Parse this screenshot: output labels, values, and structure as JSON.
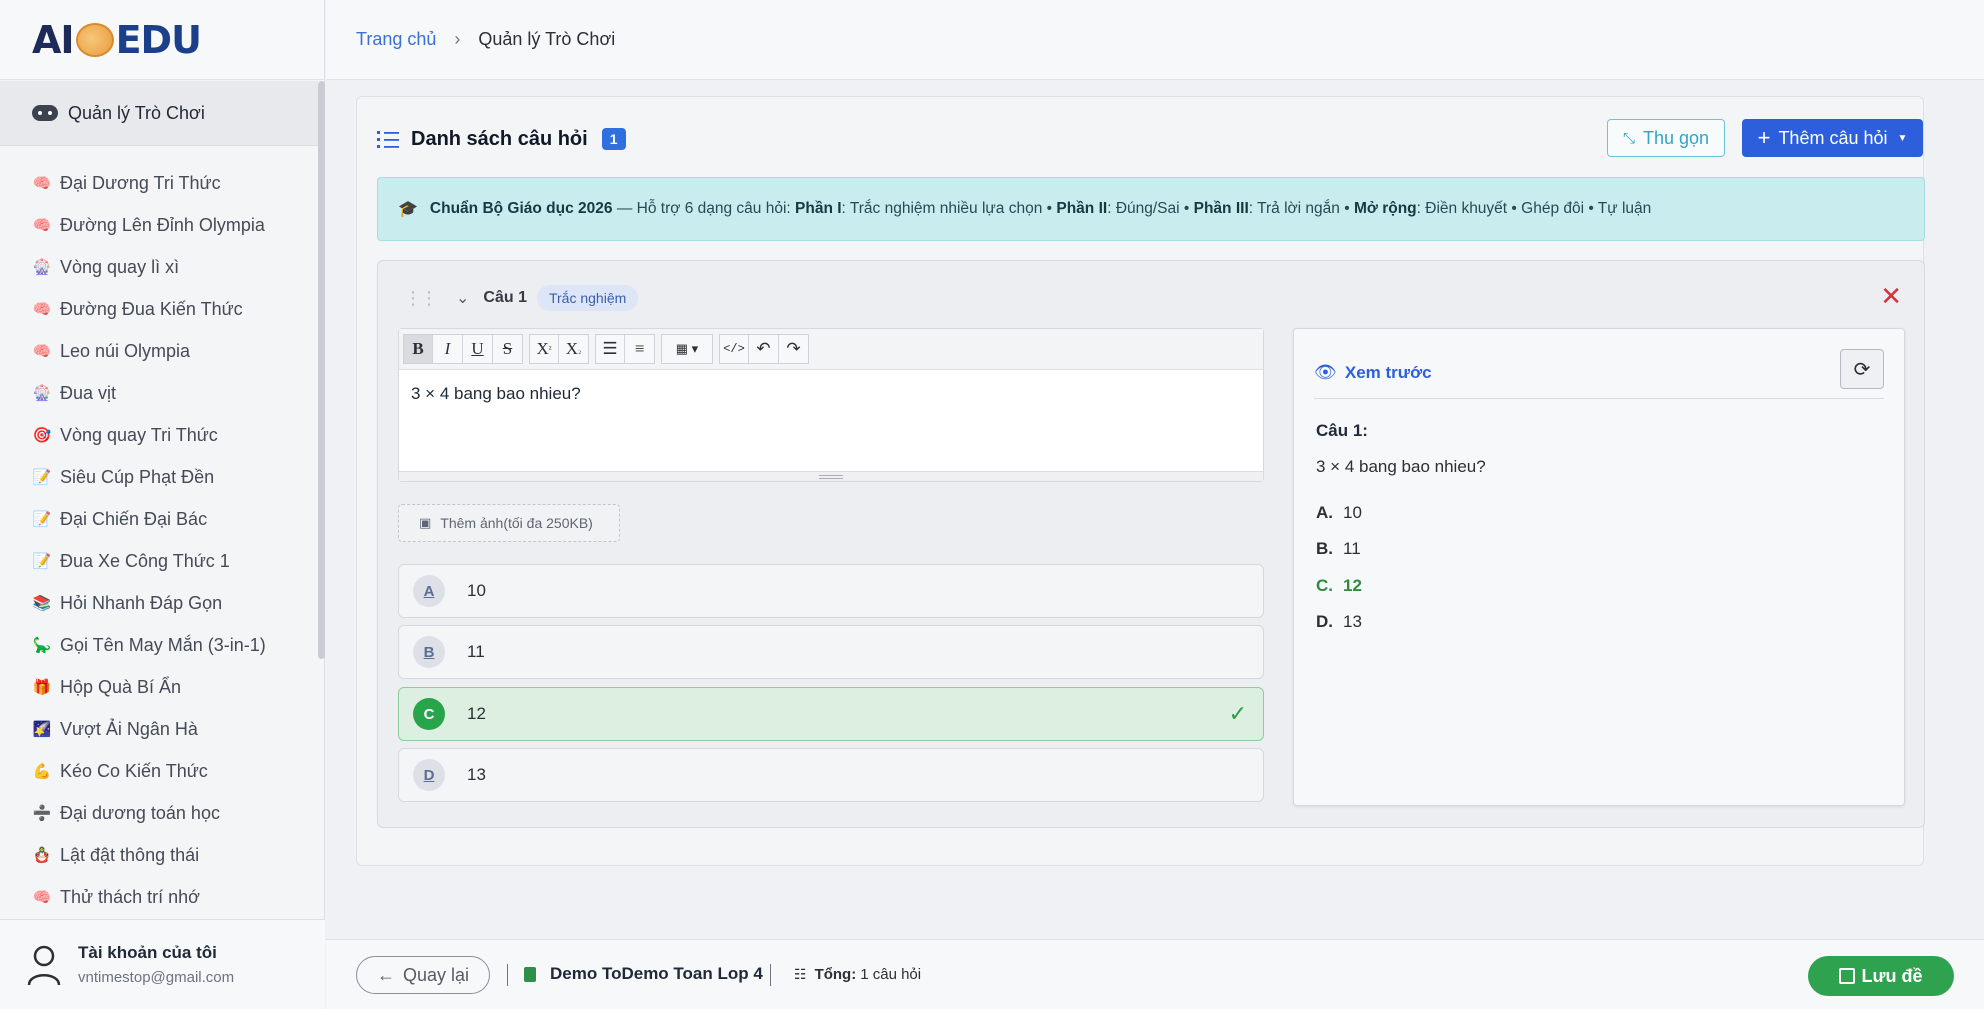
{
  "logo": {
    "ai": "AI",
    "edu": "EDU"
  },
  "sidebar": {
    "active_label": "Quản lý Trò Chơi",
    "games": [
      {
        "icon": "🧠",
        "label": "Đại Dương Tri Thức"
      },
      {
        "icon": "🧠",
        "label": "Đường Lên Đỉnh Olympia"
      },
      {
        "icon": "🎡",
        "label": "Vòng quay lì xì"
      },
      {
        "icon": "🧠",
        "label": "Đường Đua Kiến Thức"
      },
      {
        "icon": "🧠",
        "label": "Leo núi Olympia"
      },
      {
        "icon": "🎡",
        "label": "Đua vịt"
      },
      {
        "icon": "🎯",
        "label": "Vòng quay Tri Thức"
      },
      {
        "icon": "📝",
        "label": "Siêu Cúp Phạt Đền"
      },
      {
        "icon": "📝",
        "label": "Đại Chiến Đại Bác"
      },
      {
        "icon": "📝",
        "label": "Đua Xe Công Thức 1"
      },
      {
        "icon": "📚",
        "label": "Hỏi Nhanh Đáp Gọn"
      },
      {
        "icon": "🦕",
        "label": "Gọi Tên May Mắn (3-in-1)"
      },
      {
        "icon": "🎁",
        "label": "Hộp Quà Bí Ẩn"
      },
      {
        "icon": "🌠",
        "label": "Vượt Ải Ngân Hà"
      },
      {
        "icon": "💪",
        "label": "Kéo Co Kiến Thức"
      },
      {
        "icon": "➗",
        "label": "Đại dương toán học"
      },
      {
        "icon": "🪆",
        "label": "Lật đật thông thái"
      },
      {
        "icon": "🧠",
        "label": "Thử thách trí nhớ"
      }
    ],
    "account": {
      "name": "Tài khoản của tôi",
      "email": "vntimestop@gmail.com"
    }
  },
  "breadcrumb": {
    "home": "Trang chủ",
    "current": "Quản lý Trò Chơi"
  },
  "card": {
    "title": "Danh sách câu hỏi",
    "count": "1",
    "collapse_label": "Thu gọn",
    "add_label": "Thêm câu hỏi"
  },
  "info": {
    "b1": "Chuẩn Bộ Giáo dục 2026",
    "t1": " — Hỗ trợ 6 dạng câu hỏi: ",
    "b2": "Phần I",
    "t2": ": Trắc nghiệm nhiều lựa chọn • ",
    "b3": "Phần II",
    "t3": ": Đúng/Sai • ",
    "b4": "Phần III",
    "t4": ": Trả lời ngắn • ",
    "b5": "Mở rộng",
    "t5": ": Điền khuyết • Ghép đôi • Tự luận"
  },
  "question": {
    "label": "Câu 1",
    "type": "Trắc nghiệm",
    "text": "3 × 4 bang bao nhieu?",
    "add_image": "Thêm ảnh(tối đa 250KB)",
    "answers": [
      {
        "letter": "A",
        "value": "10"
      },
      {
        "letter": "B",
        "value": "11"
      },
      {
        "letter": "C",
        "value": "12"
      },
      {
        "letter": "D",
        "value": "13"
      }
    ],
    "correct": "C"
  },
  "preview": {
    "title": "Xem trước",
    "q_label": "Câu 1:",
    "q_text": "3 × 4 bang bao nhieu?",
    "opts": [
      {
        "letter": "A.",
        "value": "10"
      },
      {
        "letter": "B.",
        "value": "11"
      },
      {
        "letter": "C.",
        "value": "12"
      },
      {
        "letter": "D.",
        "value": "13"
      }
    ]
  },
  "bottom": {
    "back_label": "Quay lại",
    "doc_name": "Demo ToDemo Toan Lop 4",
    "total_label": "Tổng:",
    "total_value": "1 câu hỏi",
    "save_label": "Lưu đề"
  },
  "colors": {
    "primary": "#2d5fdc",
    "success": "#2ea24e",
    "info": "#c9ecef",
    "danger": "#d0343f"
  }
}
